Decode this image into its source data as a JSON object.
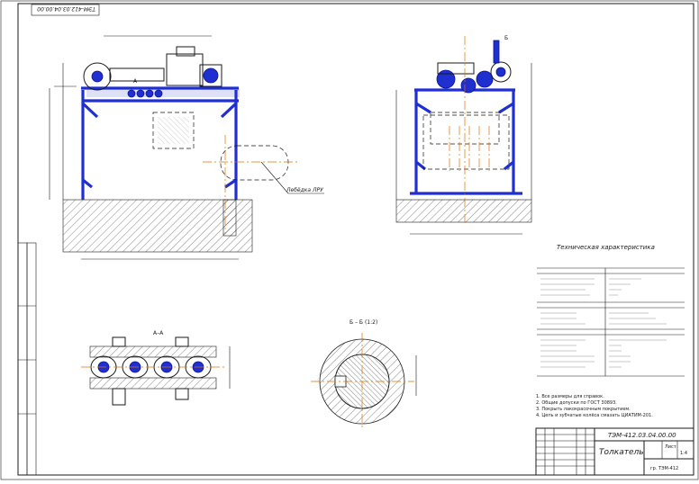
{
  "drawing": {
    "doc_code_top": "ТЭМ-412.03.04.00.00",
    "callout_lebedka": "Лебёдка ЛРУ",
    "section_AA_label": "А–А",
    "section_BB_label": "Б – Б (1:2)",
    "label_A": "А",
    "label_B": "Б"
  },
  "characteristics": {
    "heading": "Техническая характеристика",
    "notes": [
      "1. Все размеры для справок.",
      "2. Общие допуски по ГОСТ 30893.",
      "3. Покрыть лакокрасочным покрытием.",
      "4. Цепь и зубчатые колёса смазать ЦИАТИМ-201."
    ]
  },
  "title_block": {
    "doc_code": "ТЭМ-412.03.04.00.00",
    "name": "Толкатель",
    "sheet": "Лист",
    "scale": "1:4",
    "org": "гр. ТЭМ-412"
  }
}
